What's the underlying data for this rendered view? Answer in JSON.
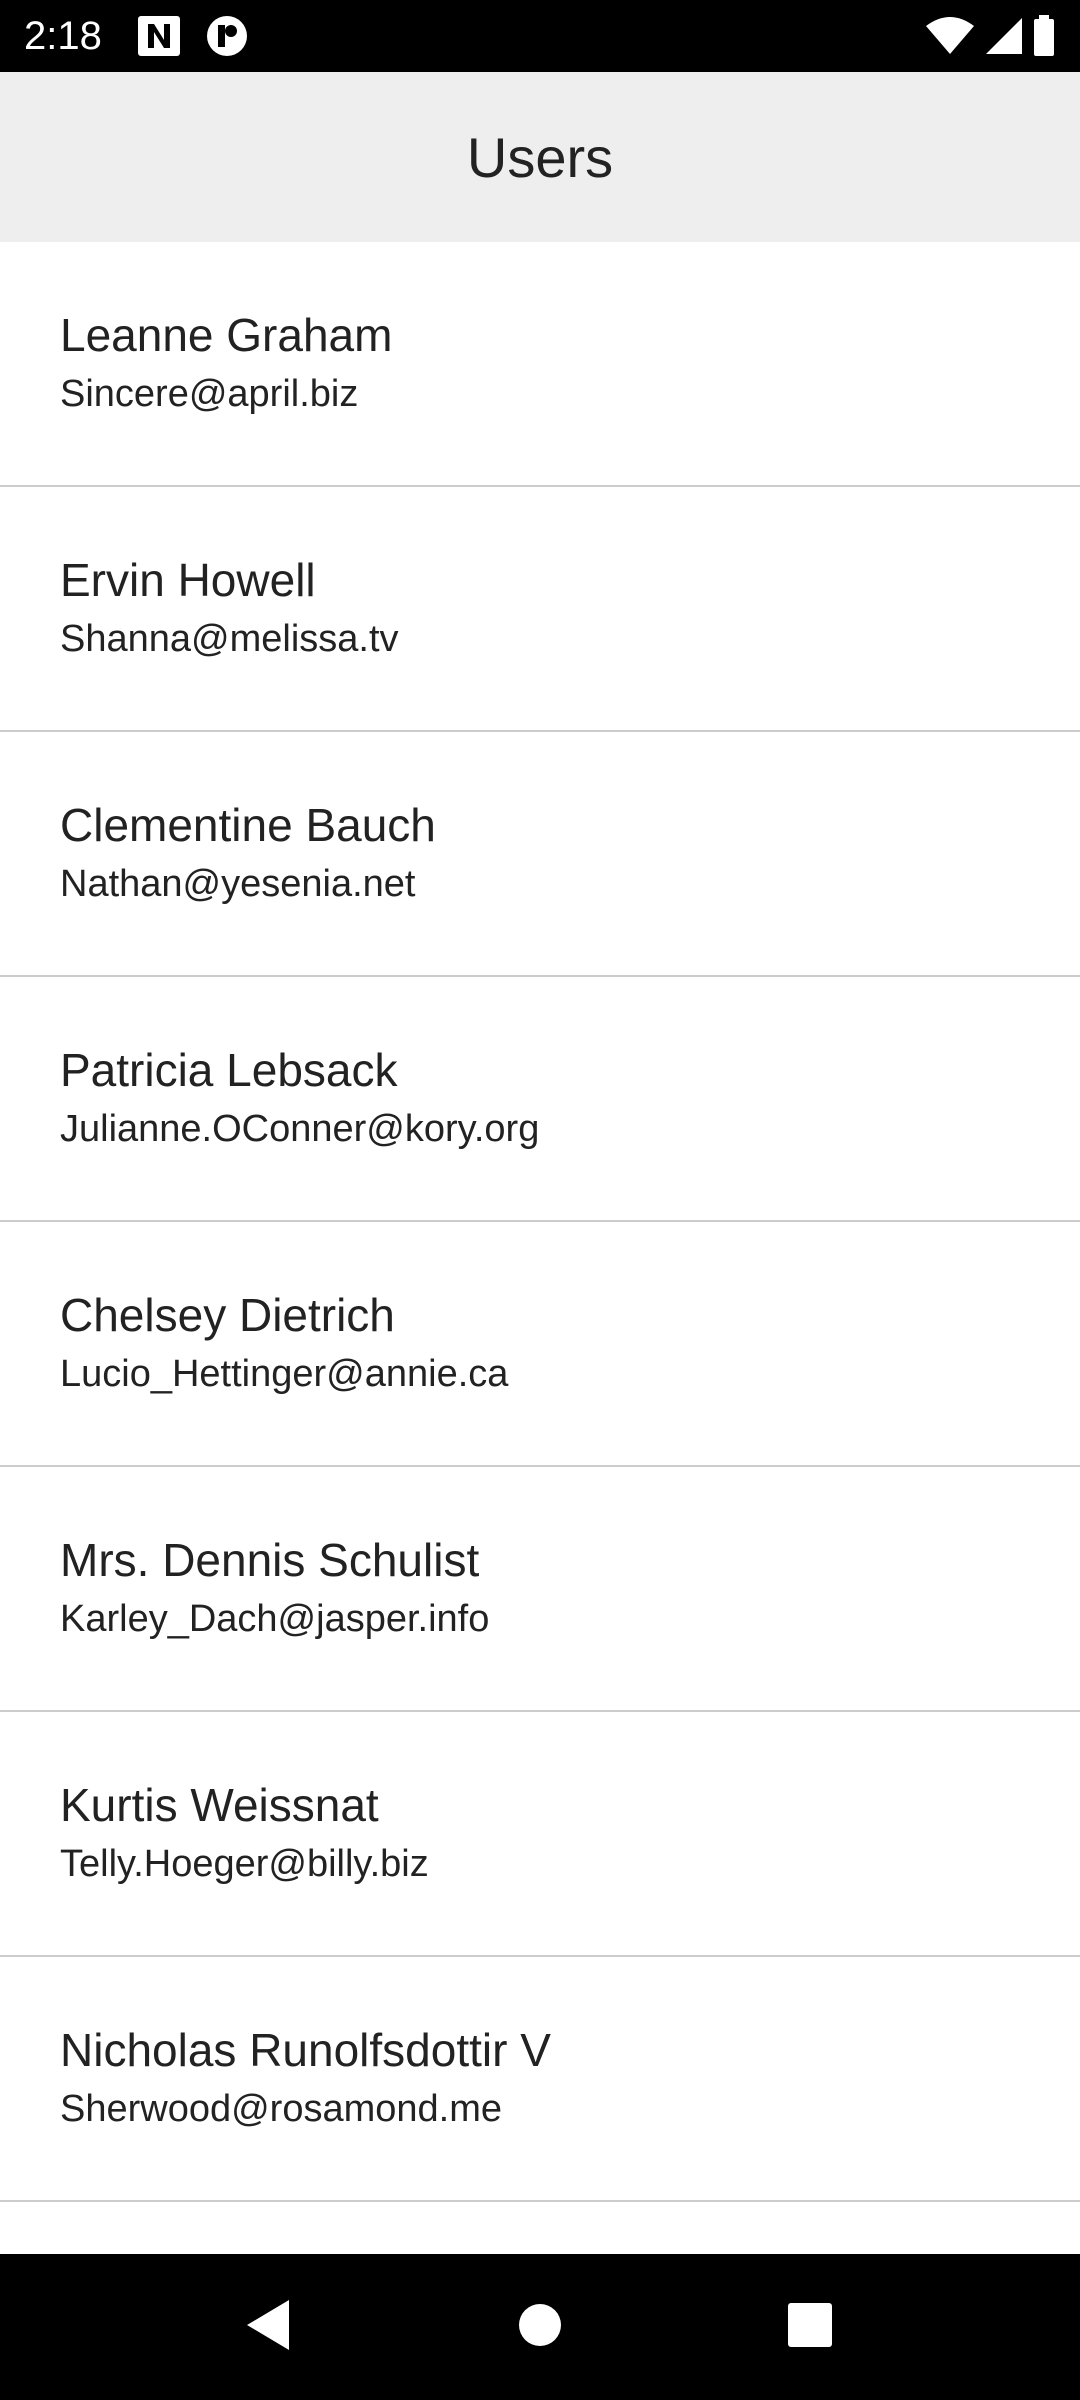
{
  "status_bar": {
    "time": "2:18",
    "icons": [
      "notification-n-icon",
      "notification-circle-icon",
      "wifi-icon",
      "cell-signal-icon",
      "battery-icon"
    ]
  },
  "header": {
    "title": "Users"
  },
  "users": [
    {
      "name": "Leanne Graham",
      "email": "Sincere@april.biz"
    },
    {
      "name": "Ervin Howell",
      "email": "Shanna@melissa.tv"
    },
    {
      "name": "Clementine Bauch",
      "email": "Nathan@yesenia.net"
    },
    {
      "name": "Patricia Lebsack",
      "email": "Julianne.OConner@kory.org"
    },
    {
      "name": "Chelsey Dietrich",
      "email": "Lucio_Hettinger@annie.ca"
    },
    {
      "name": "Mrs. Dennis Schulist",
      "email": "Karley_Dach@jasper.info"
    },
    {
      "name": "Kurtis Weissnat",
      "email": "Telly.Hoeger@billy.biz"
    },
    {
      "name": "Nicholas Runolfsdottir V",
      "email": "Sherwood@rosamond.me"
    }
  ],
  "nav_bar": {
    "buttons": [
      "back-icon",
      "home-icon",
      "recents-icon"
    ]
  },
  "colors": {
    "header_bg": "#eeeeee",
    "divider": "#cccccc",
    "text": "#222222",
    "system_bar": "#000000"
  }
}
